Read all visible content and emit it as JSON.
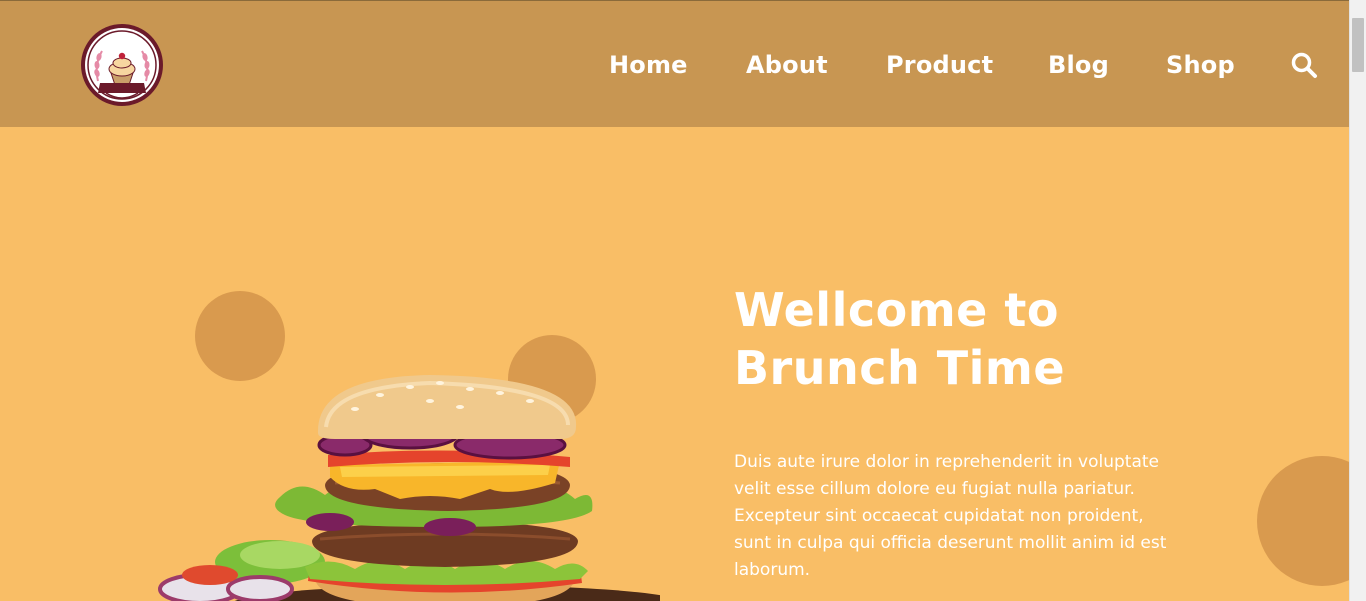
{
  "header": {
    "logo": {
      "est_text": "EST.2025",
      "name": "ARCHANA",
      "sub": "Bakery"
    },
    "nav": [
      {
        "label": "Home"
      },
      {
        "label": "About"
      },
      {
        "label": "Product"
      },
      {
        "label": "Blog"
      },
      {
        "label": "Shop"
      }
    ],
    "search_icon": "search-icon"
  },
  "hero": {
    "title_line1": "Wellcome to",
    "title_line2": "Brunch Time",
    "text": "Duis aute irure dolor in reprehenderit in voluptate velit esse cillum dolore eu fugiat nulla pariatur. Excepteur sint occaecat cupidatat non proident, sunt in culpa qui officia deserunt mollit anim id est laborum.",
    "image": "burger-image"
  },
  "colors": {
    "header_bg": "#c89652",
    "hero_bg": "#f9be66",
    "bubble": "#d99a4e",
    "text": "#ffffff",
    "logo_maroon": "#6b1a2a"
  }
}
